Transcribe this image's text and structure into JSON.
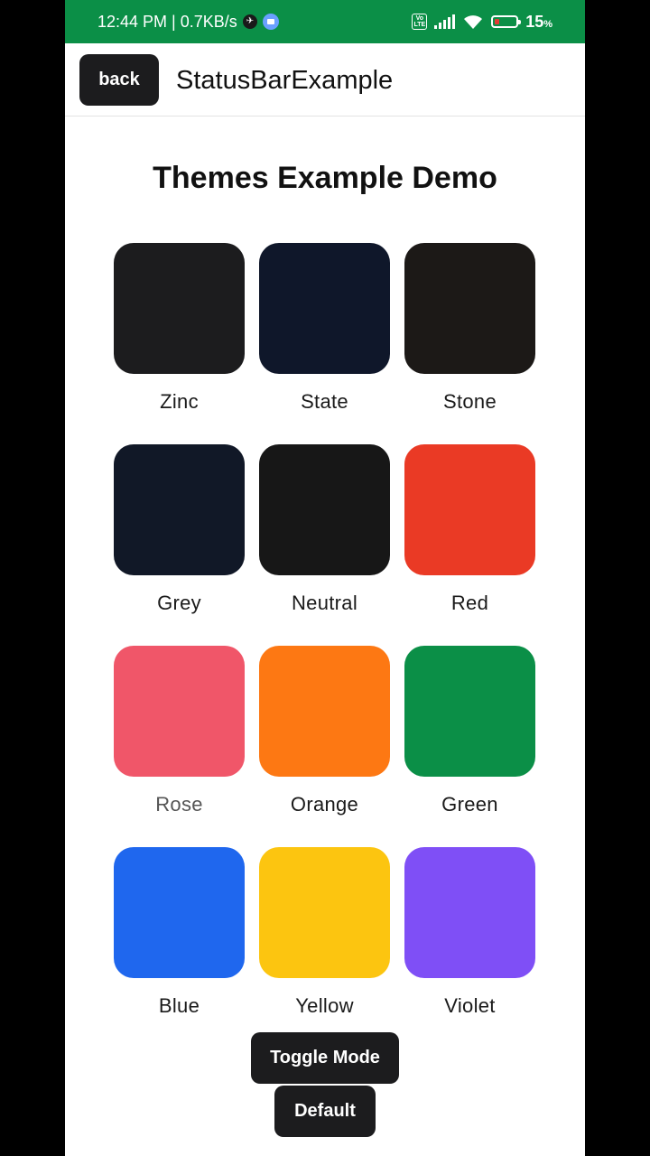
{
  "status_bar": {
    "time_speed": "12:44 PM | 0.7KB/s",
    "volte": "Vo LTE",
    "battery_percent": "15",
    "battery_unit": "%",
    "battery_level": 0.15,
    "background": "#0b8f47"
  },
  "header": {
    "back_label": "back",
    "title": "StatusBarExample"
  },
  "page": {
    "title": "Themes Example Demo"
  },
  "themes": [
    {
      "label": "Zinc",
      "color": "#1c1c1e"
    },
    {
      "label": "State",
      "color": "#0f172a"
    },
    {
      "label": "Stone",
      "color": "#1c1917"
    },
    {
      "label": "Grey",
      "color": "#111827"
    },
    {
      "label": "Neutral",
      "color": "#171717"
    },
    {
      "label": "Red",
      "color": "#ea3a25"
    },
    {
      "label": "Rose",
      "color": "#f05669"
    },
    {
      "label": "Orange",
      "color": "#fd7813"
    },
    {
      "label": "Green",
      "color": "#0b8f47"
    },
    {
      "label": "Blue",
      "color": "#1f67ee"
    },
    {
      "label": "Yellow",
      "color": "#fcc510"
    },
    {
      "label": "Violet",
      "color": "#7f4ff6"
    }
  ],
  "actions": {
    "toggle_label": "Toggle Mode",
    "default_label": "Default"
  }
}
